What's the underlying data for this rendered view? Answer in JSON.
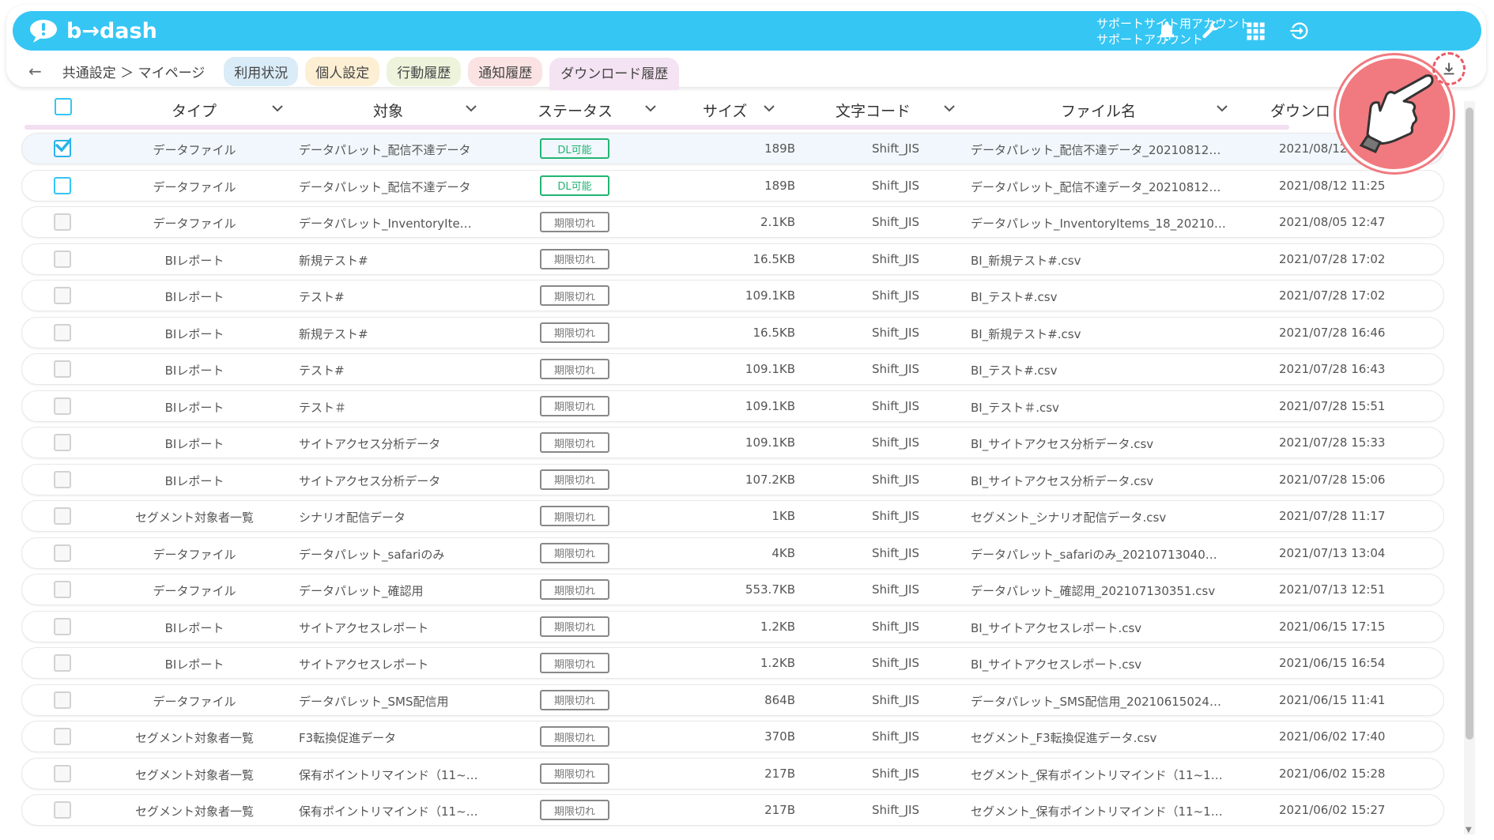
{
  "app": {
    "logo": "b→dash"
  },
  "account": {
    "line1": "サポートサイト用アカウント",
    "line2": "サポートアカウント"
  },
  "icons": {
    "bell": "bell-icon",
    "wrench": "wrench-icon",
    "grid": "grid-icon",
    "logout": "logout-icon",
    "download": "download-icon",
    "hand": "pointing-hand-icon"
  },
  "breadcrumb": {
    "back": "←",
    "text": "共通設定 ＞ マイページ"
  },
  "tabs": [
    {
      "label": "利用状況",
      "color": "#d9ecf7"
    },
    {
      "label": "個人設定",
      "color": "#fcefd4"
    },
    {
      "label": "行動履歴",
      "color": "#eef3dc"
    },
    {
      "label": "通知履歴",
      "color": "#fbe3e3"
    },
    {
      "label": "ダウンロード履歴",
      "color": "#f4e3f2"
    }
  ],
  "columns": [
    "タイプ",
    "対象",
    "ステータス",
    "サイズ",
    "文字コード",
    "ファイル名",
    "ダウンロ"
  ],
  "badges": {
    "ok": "DL可能",
    "expired": "期限切れ"
  },
  "rows": [
    {
      "type": "データファイル",
      "target": "データパレット_配信不達データ",
      "status": "DL可能",
      "size": "189B",
      "enc": "Shift_JIS",
      "fname": "データパレット_配信不達データ_20210812…",
      "date": "2021/08/12"
    },
    {
      "type": "データファイル",
      "target": "データパレット_配信不達データ",
      "status": "DL可能",
      "size": "189B",
      "enc": "Shift_JIS",
      "fname": "データパレット_配信不達データ_20210812…",
      "date": "2021/08/12 11:25"
    },
    {
      "type": "データファイル",
      "target": "データパレット_InventoryIte…",
      "status": "期限切れ",
      "size": "2.1KB",
      "enc": "Shift_JIS",
      "fname": "データパレット_InventoryItems_18_20210…",
      "date": "2021/08/05 12:47"
    },
    {
      "type": "BIレポート",
      "target": "新規テスト#",
      "status": "期限切れ",
      "size": "16.5KB",
      "enc": "Shift_JIS",
      "fname": "BI_新規テスト#.csv",
      "date": "2021/07/28 17:02"
    },
    {
      "type": "BIレポート",
      "target": "テスト#",
      "status": "期限切れ",
      "size": "109.1KB",
      "enc": "Shift_JIS",
      "fname": "BI_テスト#.csv",
      "date": "2021/07/28 17:02"
    },
    {
      "type": "BIレポート",
      "target": "新規テスト#",
      "status": "期限切れ",
      "size": "16.5KB",
      "enc": "Shift_JIS",
      "fname": "BI_新規テスト#.csv",
      "date": "2021/07/28 16:46"
    },
    {
      "type": "BIレポート",
      "target": "テスト#",
      "status": "期限切れ",
      "size": "109.1KB",
      "enc": "Shift_JIS",
      "fname": "BI_テスト#.csv",
      "date": "2021/07/28 16:43"
    },
    {
      "type": "BIレポート",
      "target": "テスト＃",
      "status": "期限切れ",
      "size": "109.1KB",
      "enc": "Shift_JIS",
      "fname": "BI_テスト＃.csv",
      "date": "2021/07/28 15:51"
    },
    {
      "type": "BIレポート",
      "target": "サイトアクセス分析データ",
      "status": "期限切れ",
      "size": "109.1KB",
      "enc": "Shift_JIS",
      "fname": "BI_サイトアクセス分析データ.csv",
      "date": "2021/07/28 15:33"
    },
    {
      "type": "BIレポート",
      "target": "サイトアクセス分析データ",
      "status": "期限切れ",
      "size": "107.2KB",
      "enc": "Shift_JIS",
      "fname": "BI_サイトアクセス分析データ.csv",
      "date": "2021/07/28 15:06"
    },
    {
      "type": "セグメント対象者一覧",
      "target": "シナリオ配信データ",
      "status": "期限切れ",
      "size": "1KB",
      "enc": "Shift_JIS",
      "fname": "セグメント_シナリオ配信データ.csv",
      "date": "2021/07/28 11:17"
    },
    {
      "type": "データファイル",
      "target": "データパレット_safariのみ",
      "status": "期限切れ",
      "size": "4KB",
      "enc": "Shift_JIS",
      "fname": "データパレット_safariのみ_20210713040…",
      "date": "2021/07/13 13:04"
    },
    {
      "type": "データファイル",
      "target": "データパレット_確認用",
      "status": "期限切れ",
      "size": "553.7KB",
      "enc": "Shift_JIS",
      "fname": "データパレット_確認用_202107130351.csv",
      "date": "2021/07/13 12:51"
    },
    {
      "type": "BIレポート",
      "target": "サイトアクセスレポート",
      "status": "期限切れ",
      "size": "1.2KB",
      "enc": "Shift_JIS",
      "fname": "BI_サイトアクセスレポート.csv",
      "date": "2021/06/15 17:15"
    },
    {
      "type": "BIレポート",
      "target": "サイトアクセスレポート",
      "status": "期限切れ",
      "size": "1.2KB",
      "enc": "Shift_JIS",
      "fname": "BI_サイトアクセスレポート.csv",
      "date": "2021/06/15 16:54"
    },
    {
      "type": "データファイル",
      "target": "データパレット_SMS配信用",
      "status": "期限切れ",
      "size": "864B",
      "enc": "Shift_JIS",
      "fname": "データパレット_SMS配信用_20210615024…",
      "date": "2021/06/15 11:41"
    },
    {
      "type": "セグメント対象者一覧",
      "target": "F3転換促進データ",
      "status": "期限切れ",
      "size": "370B",
      "enc": "Shift_JIS",
      "fname": "セグメント_F3転換促進データ.csv",
      "date": "2021/06/02 17:40"
    },
    {
      "type": "セグメント対象者一覧",
      "target": "保有ポイントリマインド（11~…",
      "status": "期限切れ",
      "size": "217B",
      "enc": "Shift_JIS",
      "fname": "セグメント_保有ポイントリマインド（11~1…",
      "date": "2021/06/02 15:28"
    },
    {
      "type": "セグメント対象者一覧",
      "target": "保有ポイントリマインド（11~…",
      "status": "期限切れ",
      "size": "217B",
      "enc": "Shift_JIS",
      "fname": "セグメント_保有ポイントリマインド（11~1…",
      "date": "2021/06/02 15:27"
    }
  ]
}
